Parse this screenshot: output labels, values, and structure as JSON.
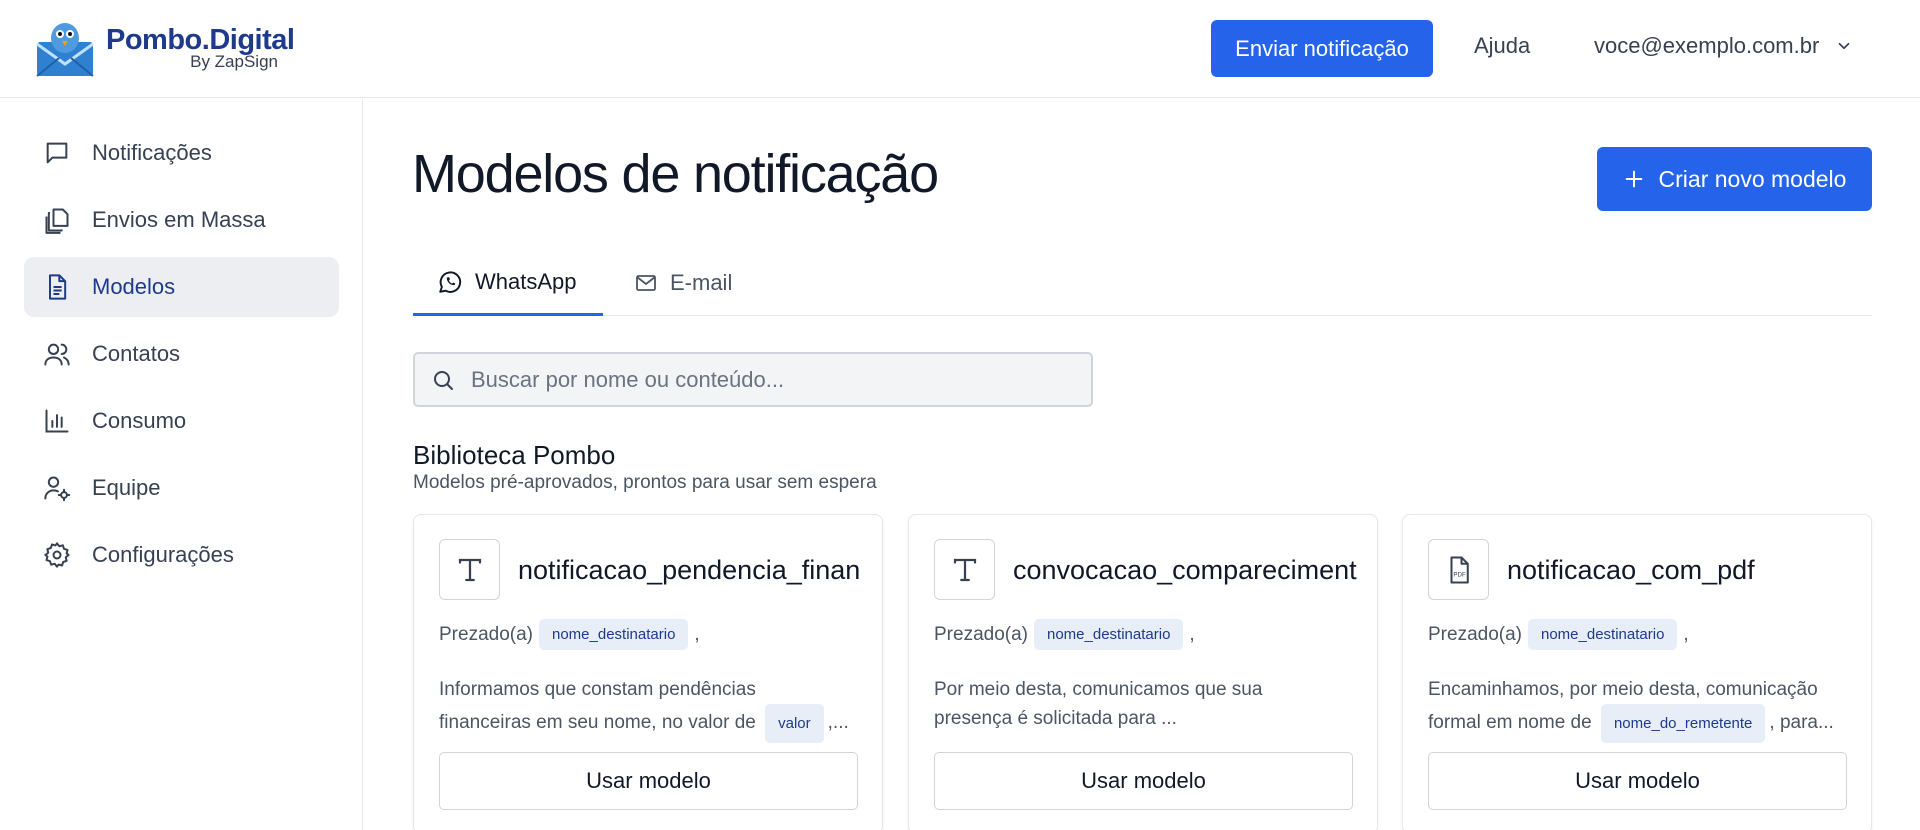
{
  "header": {
    "brand_name": "Pombo.Digital",
    "brand_sub": "By ZapSign",
    "send_button": "Enviar notificação",
    "help": "Ajuda",
    "user_email": "voce@exemplo.com.br"
  },
  "sidebar": {
    "items": [
      {
        "label": "Notificações",
        "icon": "chat-bubble-icon"
      },
      {
        "label": "Envios em Massa",
        "icon": "copy-documents-icon"
      },
      {
        "label": "Modelos",
        "icon": "document-icon",
        "active": true
      },
      {
        "label": "Contatos",
        "icon": "users-icon"
      },
      {
        "label": "Consumo",
        "icon": "bar-chart-icon"
      },
      {
        "label": "Equipe",
        "icon": "user-gear-icon"
      },
      {
        "label": "Configurações",
        "icon": "gear-icon"
      }
    ]
  },
  "main": {
    "title": "Modelos de notificação",
    "create_button": "Criar novo modelo",
    "tabs": [
      {
        "label": "WhatsApp",
        "active": true
      },
      {
        "label": "E-mail",
        "active": false
      }
    ],
    "search_placeholder": "Buscar por nome ou conteúdo...",
    "library_title": "Biblioteca Pombo",
    "library_subtitle": "Modelos pré-aprovados, prontos para usar sem espera",
    "cards": [
      {
        "name": "notificacao_pendencia_finan",
        "icon": "text-icon",
        "greeting": "Prezado(a)",
        "greeting_var": "nome_destinatario",
        "greeting_end": ",",
        "body_line1": "Informamos que constam pendências",
        "body_line2": "financeiras em seu nome, no valor de",
        "body_var": "valor",
        "body_end": ",...",
        "button": "Usar modelo"
      },
      {
        "name": "convocacao_compareciment",
        "icon": "text-icon",
        "greeting": "Prezado(a)",
        "greeting_var": "nome_destinatario",
        "greeting_end": ",",
        "body_line1": "Por meio desta, comunicamos que sua",
        "body_line2": "presença é solicitada para ...",
        "button": "Usar modelo"
      },
      {
        "name": "notificacao_com_pdf",
        "icon": "pdf-file-icon",
        "greeting": "Prezado(a)",
        "greeting_var": "nome_destinatario",
        "greeting_end": ",",
        "body_line1": "Encaminhamos, por meio desta, comunicação",
        "body_line2": "formal em nome de",
        "body_var": "nome_do_remetente",
        "body_end": ", para...",
        "button": "Usar modelo"
      }
    ]
  },
  "colors": {
    "primary": "#2563eb",
    "brand_dark": "#1e3a8a",
    "active_nav_bg": "#eceef1",
    "chip_bg": "#e8eef7"
  }
}
